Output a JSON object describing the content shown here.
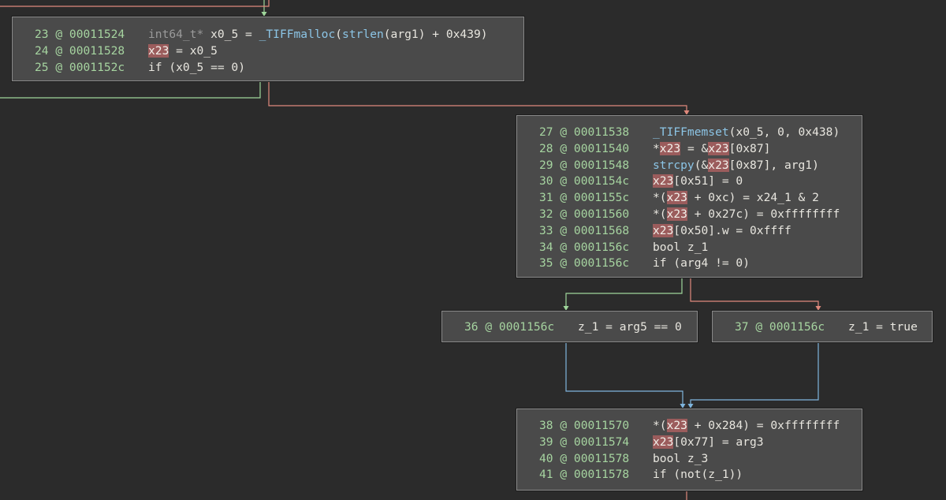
{
  "blocks": [
    {
      "lines": [
        {
          "index": "23 @ 00011524",
          "tokens": [
            {
              "t": "int64_t*",
              "k": "ty"
            },
            {
              "t": " x0_5 = ",
              "k": "var"
            },
            {
              "t": "_TIFFmalloc",
              "k": "fn"
            },
            {
              "t": "(",
              "k": "op"
            },
            {
              "t": "strlen",
              "k": "fn"
            },
            {
              "t": "(arg1) + 0x439)",
              "k": "var"
            }
          ]
        },
        {
          "index": "24 @ 00011528",
          "tokens": [
            {
              "t": "x23",
              "k": "hl"
            },
            {
              "t": " = x0_5",
              "k": "var"
            }
          ]
        },
        {
          "index": "25 @ 0001152c",
          "tokens": [
            {
              "t": "if (x0_5 == 0)",
              "k": "var"
            }
          ]
        }
      ]
    },
    {
      "lines": [
        {
          "index": "27 @ 00011538",
          "tokens": [
            {
              "t": "_TIFFmemset",
              "k": "fn"
            },
            {
              "t": "(x0_5, 0, 0x438)",
              "k": "var"
            }
          ]
        },
        {
          "index": "28 @ 00011540",
          "tokens": [
            {
              "t": "*",
              "k": "var"
            },
            {
              "t": "x23",
              "k": "hl"
            },
            {
              "t": " = &",
              "k": "var"
            },
            {
              "t": "x23",
              "k": "hl"
            },
            {
              "t": "[0x87]",
              "k": "var"
            }
          ]
        },
        {
          "index": "29 @ 00011548",
          "tokens": [
            {
              "t": "strcpy",
              "k": "fn"
            },
            {
              "t": "(&",
              "k": "var"
            },
            {
              "t": "x23",
              "k": "hl"
            },
            {
              "t": "[0x87], arg1)",
              "k": "var"
            }
          ]
        },
        {
          "index": "30 @ 0001154c",
          "tokens": [
            {
              "t": "x23",
              "k": "hl"
            },
            {
              "t": "[0x51] = 0",
              "k": "var"
            }
          ]
        },
        {
          "index": "31 @ 0001155c",
          "tokens": [
            {
              "t": "*(",
              "k": "var"
            },
            {
              "t": "x23",
              "k": "hl"
            },
            {
              "t": " + 0xc) = x24_1 & 2",
              "k": "var"
            }
          ]
        },
        {
          "index": "32 @ 00011560",
          "tokens": [
            {
              "t": "*(",
              "k": "var"
            },
            {
              "t": "x23",
              "k": "hl"
            },
            {
              "t": " + 0x27c) = 0xffffffff",
              "k": "var"
            }
          ]
        },
        {
          "index": "33 @ 00011568",
          "tokens": [
            {
              "t": "x23",
              "k": "hl"
            },
            {
              "t": "[0x50].w = 0xffff",
              "k": "var"
            }
          ]
        },
        {
          "index": "34 @ 0001156c",
          "tokens": [
            {
              "t": "bool z_1",
              "k": "var"
            }
          ]
        },
        {
          "index": "35 @ 0001156c",
          "tokens": [
            {
              "t": "if (arg4 != 0)",
              "k": "var"
            }
          ]
        }
      ]
    },
    {
      "lines": [
        {
          "index": "36 @ 0001156c",
          "tokens": [
            {
              "t": "z_1 = arg5 == 0",
              "k": "var"
            }
          ]
        }
      ]
    },
    {
      "lines": [
        {
          "index": "37 @ 0001156c",
          "tokens": [
            {
              "t": "z_1 = true",
              "k": "var"
            }
          ]
        }
      ]
    },
    {
      "lines": [
        {
          "index": "38 @ 00011570",
          "tokens": [
            {
              "t": "*(",
              "k": "var"
            },
            {
              "t": "x23",
              "k": "hl"
            },
            {
              "t": " + 0x284) = 0xffffffff",
              "k": "var"
            }
          ]
        },
        {
          "index": "39 @ 00011574",
          "tokens": [
            {
              "t": "x23",
              "k": "hl"
            },
            {
              "t": "[0x77] = arg3",
              "k": "var"
            }
          ]
        },
        {
          "index": "40 @ 00011578",
          "tokens": [
            {
              "t": "bool z_3",
              "k": "var"
            }
          ]
        },
        {
          "index": "41 @ 00011578",
          "tokens": [
            {
              "t": "if (not(z_1))",
              "k": "var"
            }
          ]
        }
      ]
    }
  ],
  "edges": [
    {
      "kind": "true",
      "color": "#9fd69b"
    },
    {
      "kind": "false",
      "color": "#e0897c"
    },
    {
      "kind": "unconditional",
      "color": "#7fb5de"
    },
    {
      "kind": "offscreen",
      "color": "#9fd69b"
    }
  ]
}
